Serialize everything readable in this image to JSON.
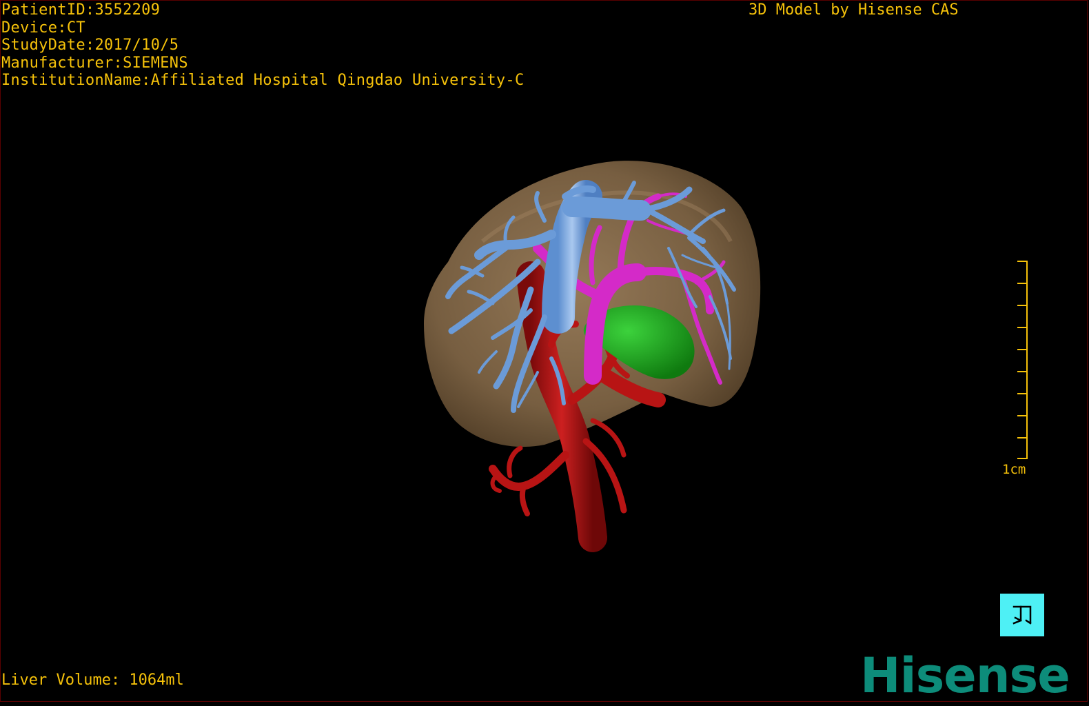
{
  "overlay": {
    "patient_id": "PatientID:3552209",
    "device": "Device:CT",
    "study_date": "StudyDate:2017/10/5",
    "manufacturer": "Manufacturer:SIEMENS",
    "institution": "InstitutionName:Affiliated Hospital Qingdao University-C",
    "credit": "3D Model by Hisense CAS",
    "liver_volume": "Liver Volume: 1064ml"
  },
  "scale_bar": {
    "label": "1cm"
  },
  "brand": {
    "name": "Hisense"
  },
  "colors": {
    "overlay_text": "#f6c20a",
    "background": "#000000",
    "liver": "#8c7150",
    "hepatic_vein": "#6b9bd8",
    "portal_vein": "#d42ac8",
    "artery": "#b81414",
    "gallbladder": "#1ea51e",
    "reset_button": "#4ef0f5",
    "brand": "#0d8c7a"
  },
  "icons": {
    "reset_view": "reset-view-icon"
  }
}
